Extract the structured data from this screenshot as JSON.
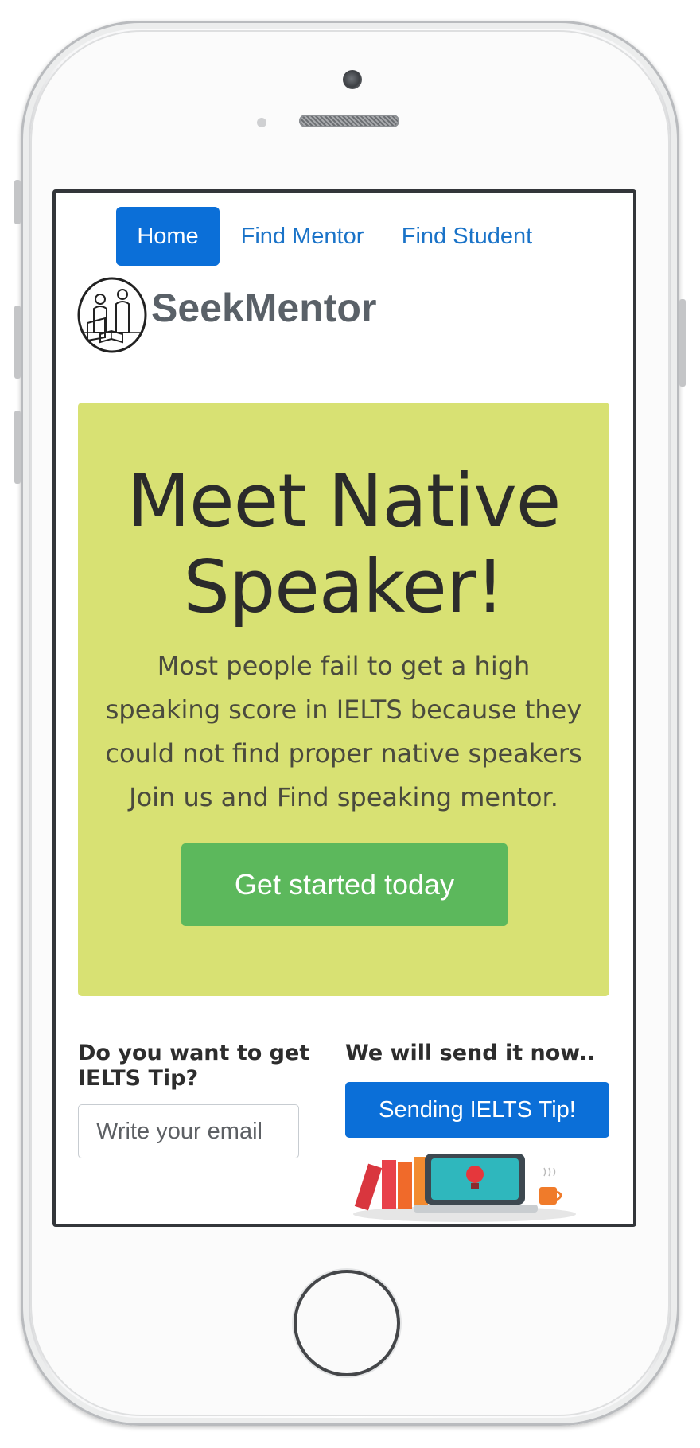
{
  "nav": {
    "items": [
      {
        "label": "Home",
        "active": true
      },
      {
        "label": "Find Mentor",
        "active": false
      },
      {
        "label": "Find Student",
        "active": false
      }
    ]
  },
  "brand": {
    "name": "SeekMentor",
    "logo_icon": "mentor-student-reading-logo-icon"
  },
  "hero": {
    "title_line1": "Meet Native",
    "title_line2": "Speaker!",
    "text_lines": [
      "Most people fail to get a high",
      "speaking score in IELTS because they",
      "could not find proper native speakers",
      "Join us and Find speaking mentor."
    ],
    "cta_label": "Get started today",
    "background": "#d8e173",
    "cta_color": "#5cb85c"
  },
  "tips": {
    "question": "Do you want to get IELTS Tip?",
    "email_placeholder": "Write your email",
    "send_text": "We will send it now..",
    "send_button_label": "Sending IELTS Tip!",
    "illustration_icon": "books-laptop-lightbulb-coffee-icon"
  },
  "colors": {
    "primary": "#0b6fd8",
    "link": "#1a73c8"
  }
}
